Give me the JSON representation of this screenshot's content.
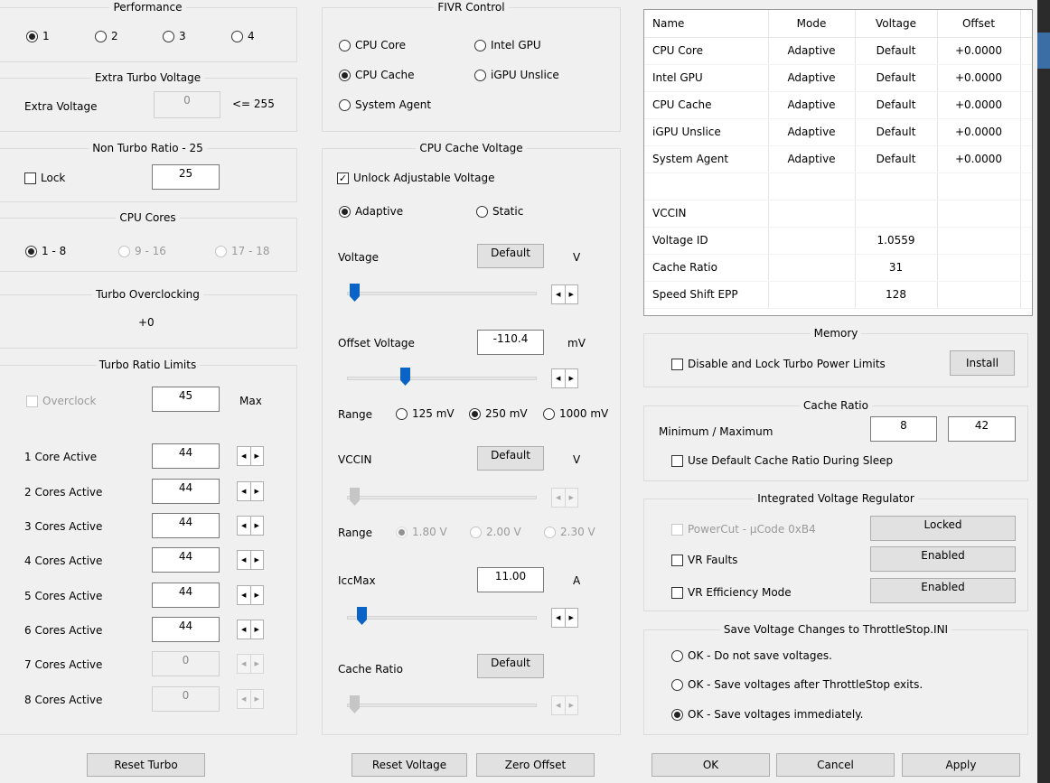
{
  "performance": {
    "title": "Performance",
    "options": [
      "1",
      "2",
      "3",
      "4"
    ],
    "selected": 0
  },
  "extra_turbo": {
    "title": "Extra Turbo Voltage",
    "label": "Extra Voltage",
    "value": "0",
    "limit": "<= 255"
  },
  "non_turbo": {
    "title": "Non Turbo Ratio - 25",
    "lock_label": "Lock",
    "lock_checked": false,
    "value": "25"
  },
  "cpu_cores": {
    "title": "CPU Cores",
    "options": [
      "1 - 8",
      "9 - 16",
      "17 - 18"
    ],
    "selected": 0
  },
  "turbo_oc": {
    "title": "Turbo Overclocking",
    "value": "+0"
  },
  "turbo_ratio": {
    "title": "Turbo Ratio Limits",
    "overclock_label": "Overclock",
    "overclock_value": "45",
    "max_label": "Max",
    "rows": [
      {
        "label": "1 Core Active",
        "value": "44",
        "enabled": true
      },
      {
        "label": "2 Cores Active",
        "value": "44",
        "enabled": true
      },
      {
        "label": "3 Cores Active",
        "value": "44",
        "enabled": true
      },
      {
        "label": "4 Cores Active",
        "value": "44",
        "enabled": true
      },
      {
        "label": "5 Cores Active",
        "value": "44",
        "enabled": true
      },
      {
        "label": "6 Cores Active",
        "value": "44",
        "enabled": true
      },
      {
        "label": "7 Cores Active",
        "value": "0",
        "enabled": false
      },
      {
        "label": "8 Cores Active",
        "value": "0",
        "enabled": false
      }
    ]
  },
  "fivr": {
    "title": "FIVR Control",
    "options": [
      "CPU Core",
      "Intel GPU",
      "CPU Cache",
      "iGPU Unslice",
      "System Agent"
    ],
    "selected": "CPU Cache"
  },
  "cache_voltage": {
    "title": "CPU Cache Voltage",
    "unlock_label": "Unlock Adjustable Voltage",
    "unlock_checked": true,
    "adaptive_label": "Adaptive",
    "static_label": "Static",
    "mode": "Adaptive",
    "voltage_label": "Voltage",
    "voltage_value": "Default",
    "voltage_unit": "V",
    "voltage_slider": 0.0,
    "offset_label": "Offset Voltage",
    "offset_value": "-110.4",
    "offset_unit": "mV",
    "offset_slider": 0.28,
    "range_label": "Range",
    "range_options": [
      "125 mV",
      "250 mV",
      "1000 mV"
    ],
    "range_selected": 1,
    "vccin_label": "VCCIN",
    "vccin_value": "Default",
    "vccin_unit": "V",
    "vccin_slider": 0.0,
    "vccin_range_label": "Range",
    "vccin_range_options": [
      "1.80 V",
      "2.00 V",
      "2.30 V"
    ],
    "iccmax_label": "IccMax",
    "iccmax_value": "11.00",
    "iccmax_unit": "A",
    "iccmax_slider": 0.04,
    "cache_ratio_label": "Cache Ratio",
    "cache_ratio_value": "Default",
    "cache_ratio_slider": 0.0
  },
  "table": {
    "headers": [
      "Name",
      "Mode",
      "Voltage",
      "Offset"
    ],
    "rows": [
      [
        "CPU Core",
        "Adaptive",
        "Default",
        "+0.0000"
      ],
      [
        "Intel GPU",
        "Adaptive",
        "Default",
        "+0.0000"
      ],
      [
        "CPU Cache",
        "Adaptive",
        "Default",
        "+0.0000"
      ],
      [
        "iGPU Unslice",
        "Adaptive",
        "Default",
        "+0.0000"
      ],
      [
        "System Agent",
        "Adaptive",
        "Default",
        "+0.0000"
      ],
      [
        "",
        "",
        "",
        ""
      ],
      [
        "VCCIN",
        "",
        "",
        ""
      ],
      [
        "Voltage ID",
        "",
        "1.0559",
        ""
      ],
      [
        "Cache Ratio",
        "",
        "31",
        ""
      ],
      [
        "Speed Shift EPP",
        "",
        "128",
        ""
      ]
    ]
  },
  "memory": {
    "title": "Memory",
    "disable_label": "Disable and Lock Turbo Power Limits",
    "install_label": "Install"
  },
  "cache_ratio": {
    "title": "Cache Ratio",
    "minmax_label": "Minimum / Maximum",
    "min": "8",
    "max": "42",
    "sleep_label": "Use Default Cache Ratio During Sleep"
  },
  "ivr": {
    "title": "Integrated Voltage Regulator",
    "powercut_label": "PowerCut  -  µCode 0xB4",
    "powercut_value": "Locked",
    "vrfaults_label": "VR Faults",
    "vrfaults_value": "Enabled",
    "vreff_label": "VR Efficiency Mode",
    "vreff_value": "Enabled"
  },
  "save": {
    "title": "Save Voltage Changes to ThrottleStop.INI",
    "options": [
      "OK - Do not save voltages.",
      "OK - Save voltages after ThrottleStop exits.",
      "OK - Save voltages immediately."
    ],
    "selected": 2
  },
  "buttons": {
    "reset_turbo": "Reset Turbo",
    "reset_voltage": "Reset Voltage",
    "zero_offset": "Zero Offset",
    "ok": "OK",
    "cancel": "Cancel",
    "apply": "Apply"
  }
}
